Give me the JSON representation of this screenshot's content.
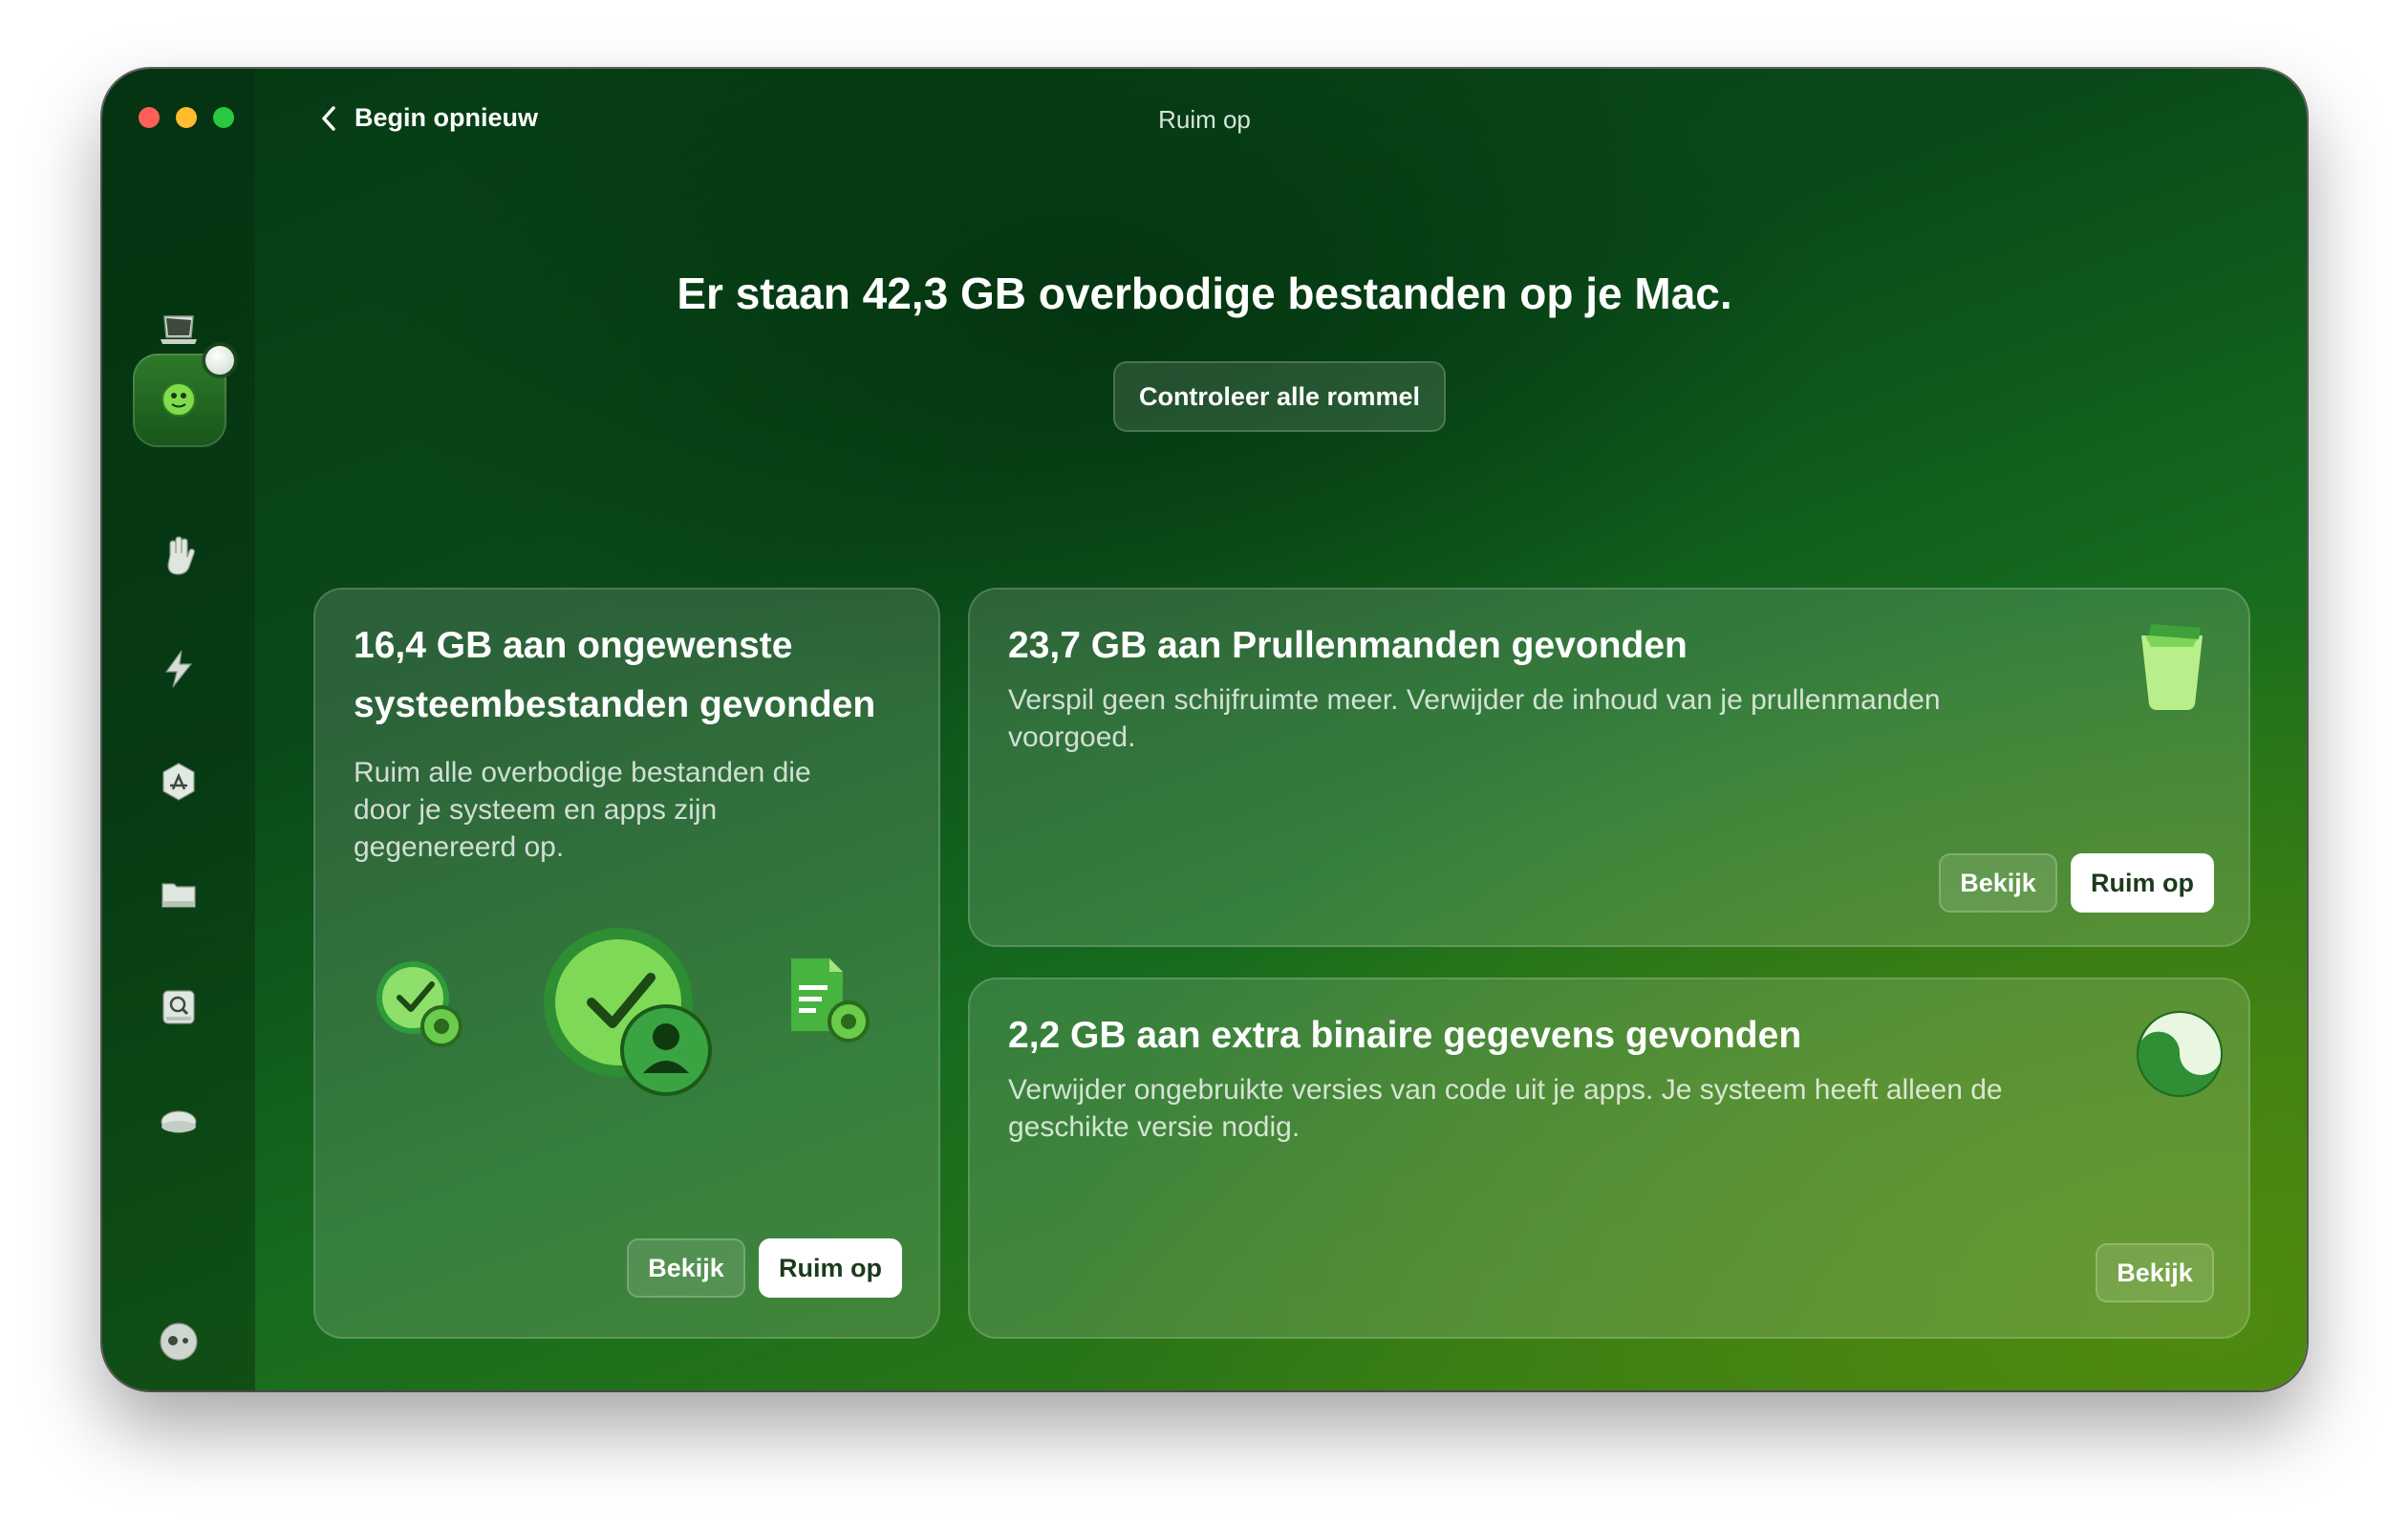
{
  "window": {
    "title": "Ruim op",
    "back_label": "Begin opnieuw"
  },
  "sidebar": {
    "items": [
      {
        "id": "monitor",
        "icon": "laptop-icon"
      },
      {
        "id": "cleanup",
        "icon": "cleanup-globe-icon",
        "active": true
      },
      {
        "id": "protection",
        "icon": "hand-icon"
      },
      {
        "id": "performance",
        "icon": "lightning-icon"
      },
      {
        "id": "applications",
        "icon": "app-store-icon"
      },
      {
        "id": "my-clutter",
        "icon": "folder-icon"
      },
      {
        "id": "cloud",
        "icon": "disk-search-icon"
      },
      {
        "id": "space-lens",
        "icon": "cloud-icon"
      },
      {
        "id": "assistant",
        "icon": "assistant-icon"
      }
    ]
  },
  "main": {
    "headline": "Er staan 42,3 GB overbodige bestanden op je Mac.",
    "review_all_label": "Controleer alle rommel"
  },
  "cards": {
    "system": {
      "title_line1": "16,4 GB aan ongewenste",
      "title_line2": "systeembestanden gevonden",
      "desc_line1": "Ruim alle overbodige bestanden die",
      "desc_line2": "door je systeem en apps zijn",
      "desc_line3": "gegenereerd op.",
      "view_label": "Bekijk",
      "clean_label": "Ruim op"
    },
    "trash": {
      "title": "23,7 GB aan Prullenmanden gevonden",
      "desc_line1": "Verspil geen schijfruimte meer. Verwijder de inhoud van je prullenmanden",
      "desc_line2": "voorgoed.",
      "view_label": "Bekijk",
      "clean_label": "Ruim op"
    },
    "binaries": {
      "title": "2,2 GB aan extra binaire gegevens gevonden",
      "desc_line1": "Verwijder ongebruikte versies van code uit je apps. Je systeem heeft alleen de",
      "desc_line2": "geschikte versie nodig.",
      "view_label": "Bekijk"
    }
  },
  "colors": {
    "accent": "#2fb344",
    "close": "#ff5f57",
    "minimize": "#febc2e",
    "zoom": "#28c840"
  }
}
